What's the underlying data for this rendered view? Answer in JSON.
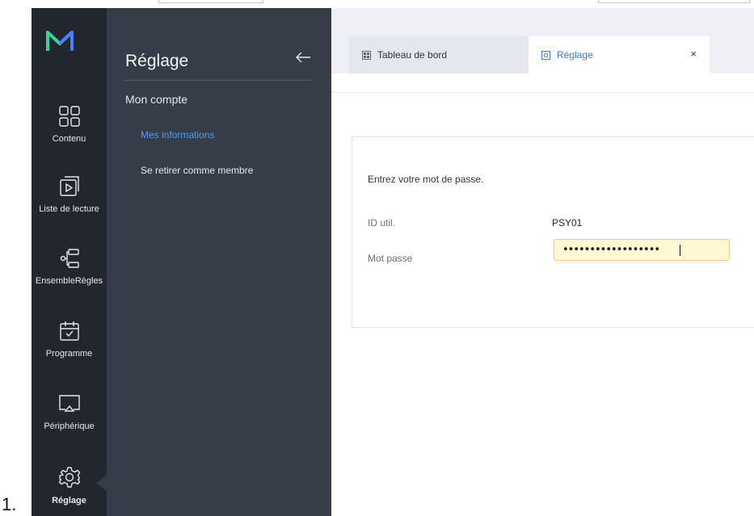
{
  "list_number": "1.",
  "colors": {
    "rail_bg": "#22262f",
    "panel_bg": "#363c48",
    "accent": "#4b9bff",
    "logo_green": "#35d39b",
    "logo_blue": "#4b7dff"
  },
  "rail": {
    "items": [
      {
        "label": "Contenu",
        "icon": "content-grid-icon"
      },
      {
        "label": "Liste de lecture",
        "icon": "playlist-icon"
      },
      {
        "label": "EnsembleRègles",
        "icon": "ruleset-icon"
      },
      {
        "label": "Programme",
        "icon": "calendar-check-icon"
      },
      {
        "label": "Périphérique",
        "icon": "monitor-icon"
      },
      {
        "label": "Réglage",
        "icon": "gear-icon",
        "active": true
      }
    ]
  },
  "panel": {
    "title": "Réglage",
    "section": "Mon compte",
    "items": [
      {
        "label": "Mes informations",
        "selected": true
      },
      {
        "label": "Se retirer comme membre"
      }
    ]
  },
  "tabs": [
    {
      "label": "Tableau de bord",
      "icon": "dashboard-icon"
    },
    {
      "label": "Réglage",
      "icon": "settings-tab-icon",
      "close": "×"
    }
  ],
  "form": {
    "prompt": "Entrez votre mot de passe.",
    "id_label": "ID util.",
    "id_value": "PSY01",
    "password_label": "Mot passe",
    "password_value": "••••••••••••••••••"
  }
}
